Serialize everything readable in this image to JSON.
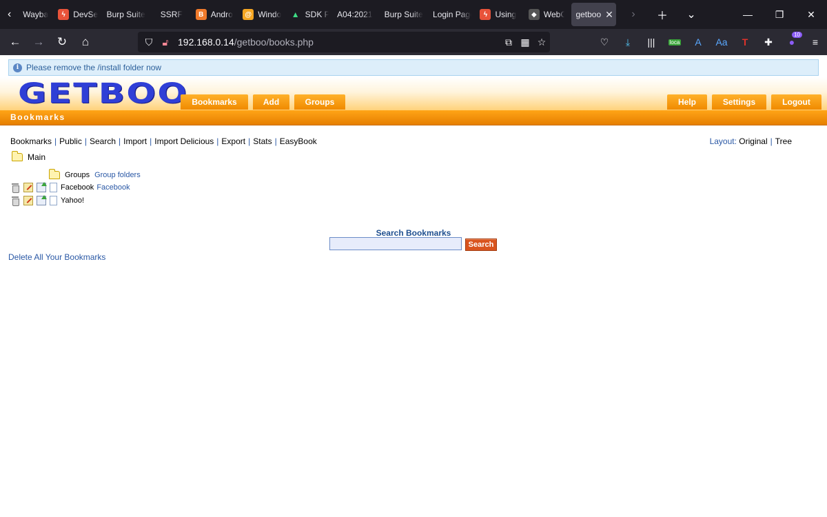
{
  "browser": {
    "tabs": [
      {
        "label": "Wayba",
        "icon": "wayback-icon",
        "color": "#1c1b22"
      },
      {
        "label": "DevSe",
        "icon": "devsec-icon",
        "color": "#e8533a"
      },
      {
        "label": "Burp Suite",
        "icon": "",
        "color": ""
      },
      {
        "label": "SSRF",
        "icon": "",
        "color": ""
      },
      {
        "label": "Andro",
        "icon": "blogger-icon",
        "color": "#f07a2b"
      },
      {
        "label": "Windo",
        "icon": "at-icon",
        "color": "#f5a623"
      },
      {
        "label": "SDK P",
        "icon": "android-icon",
        "color": "#3ddc84"
      },
      {
        "label": "A04:2021",
        "icon": "",
        "color": ""
      },
      {
        "label": "Burp Suite",
        "icon": "",
        "color": ""
      },
      {
        "label": "Login Page",
        "icon": "",
        "color": ""
      },
      {
        "label": "Using",
        "icon": "devsec-icon",
        "color": "#e8533a"
      },
      {
        "label": "WebG",
        "icon": "webgoat-icon",
        "color": "#555"
      },
      {
        "label": "getboo",
        "icon": "",
        "color": ""
      }
    ],
    "url_host": "192.168.0.14",
    "url_path": "/getboo/books.php",
    "ext_badge": "10",
    "ext_local_label": "loca"
  },
  "notice": {
    "text": "Please remove the /install folder now"
  },
  "header": {
    "logo": "GETBOO",
    "nav": {
      "bookmarks": "Bookmarks",
      "add": "Add",
      "groups": "Groups"
    },
    "right": {
      "help": "Help",
      "settings": "Settings",
      "logout": "Logout"
    },
    "section_title": "Bookmarks"
  },
  "menu": {
    "items": [
      "Bookmarks",
      "Public",
      "Search",
      "Import",
      "Import Delicious",
      "Export",
      "Stats",
      "EasyBook"
    ],
    "layout_label": "Layout:",
    "layout_options": [
      "Original",
      "Tree"
    ]
  },
  "tree": {
    "root": "Main",
    "groups_label": "Groups",
    "groups_link": "Group folders",
    "bookmarks": [
      {
        "title": "Facebook",
        "link": "Facebook"
      },
      {
        "title": "Yahoo!",
        "link": ""
      }
    ]
  },
  "search": {
    "title": "Search Bookmarks",
    "value": "",
    "button": "Search"
  },
  "delete_all": "Delete All Your Bookmarks",
  "colors": {
    "accent_orange": "#f08a00",
    "logo_blue": "#2f3fd6",
    "link_blue": "#2a58a5",
    "search_btn": "#d9541e"
  }
}
